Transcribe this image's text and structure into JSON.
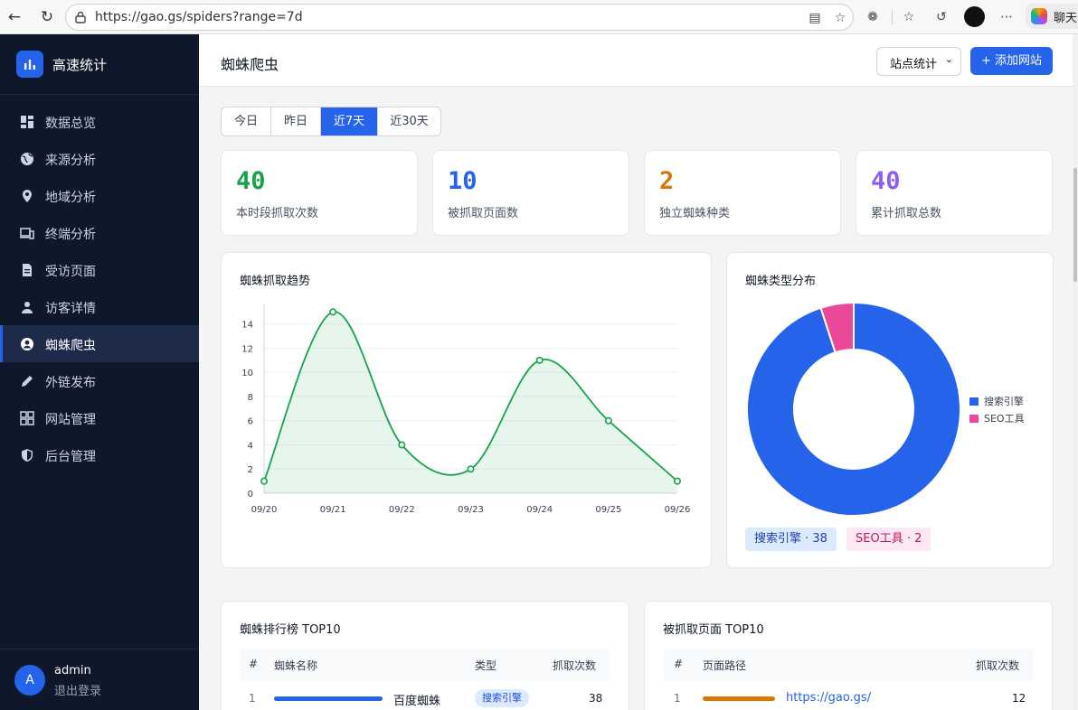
{
  "browser": {
    "url": "https://gao.gs/spiders?range=7d",
    "copilot_label": "聊天"
  },
  "sidebar": {
    "brand": "高速统计",
    "items": [
      {
        "label": "数据总览",
        "icon": "dashboard-icon"
      },
      {
        "label": "来源分析",
        "icon": "globe-icon"
      },
      {
        "label": "地域分析",
        "icon": "location-pin-icon"
      },
      {
        "label": "终端分析",
        "icon": "devices-icon"
      },
      {
        "label": "受访页面",
        "icon": "document-icon"
      },
      {
        "label": "访客详情",
        "icon": "person-icon"
      },
      {
        "label": "蜘蛛爬虫",
        "icon": "account-circle-icon",
        "active": true
      },
      {
        "label": "外链发布",
        "icon": "pencil-icon"
      },
      {
        "label": "网站管理",
        "icon": "grid-icon"
      },
      {
        "label": "后台管理",
        "icon": "shield-icon"
      }
    ],
    "user": {
      "avatar": "A",
      "name": "admin",
      "logout": "退出登录"
    }
  },
  "header": {
    "title": "蜘蛛爬虫",
    "site_select": "站点统计",
    "add_button": "+ 添加网站"
  },
  "range_tabs": [
    {
      "label": "今日"
    },
    {
      "label": "昨日"
    },
    {
      "label": "近7天",
      "active": true
    },
    {
      "label": "近30天"
    }
  ],
  "stats": [
    {
      "value": "40",
      "label": "本时段抓取次数",
      "color": "#16a34a"
    },
    {
      "value": "10",
      "label": "被抓取页面数",
      "color": "#2563eb"
    },
    {
      "value": "2",
      "label": "独立蜘蛛种类",
      "color": "#d97706"
    },
    {
      "value": "40",
      "label": "累计抓取总数",
      "color": "#8b5cf6"
    }
  ],
  "trend": {
    "title": "蜘蛛抓取趋势",
    "chart_data": {
      "type": "line",
      "x": [
        "09/20",
        "09/21",
        "09/22",
        "09/23",
        "09/24",
        "09/25",
        "09/26"
      ],
      "series": [
        {
          "values": [
            1,
            15,
            4,
            2,
            11,
            6,
            1
          ],
          "color": "#16a34a"
        }
      ],
      "yticks": [
        0,
        2,
        4,
        6,
        8,
        10,
        12,
        14
      ],
      "ylim": [
        0,
        15.4
      ],
      "grid": true,
      "smooth": true,
      "area": true
    }
  },
  "distribution": {
    "title": "蜘蛛类型分布",
    "chart_data": {
      "type": "pie",
      "donut": true,
      "labels": [
        "搜索引擎",
        "SEO工具"
      ],
      "values": [
        38,
        2
      ],
      "colors": [
        "#2563eb",
        "#ec4899"
      ],
      "legend": "right"
    },
    "pills": [
      "搜索引擎 · 38",
      "SEO工具 · 2"
    ]
  },
  "spider_rank": {
    "title": "蜘蛛排行榜 TOP10",
    "columns": [
      "#",
      "蜘蛛名称",
      "类型",
      "抓取次数"
    ],
    "rows": [
      {
        "rank": "1",
        "name": "百度蜘蛛",
        "type": "搜索引擎",
        "count": "38",
        "fill": 1.0
      }
    ]
  },
  "page_rank": {
    "title": "被抓取页面 TOP10",
    "columns": [
      "#",
      "页面路径",
      "抓取次数"
    ],
    "rows": [
      {
        "rank": "1",
        "path": "https://gao.gs/",
        "count": "12",
        "fill": 1.0
      }
    ]
  }
}
